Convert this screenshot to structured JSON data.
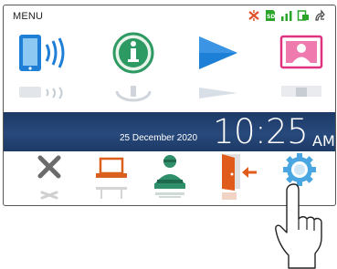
{
  "header": {
    "title": "MENU",
    "status_icons": [
      "mute-icon",
      "sd-card-icon",
      "signal-icon",
      "recording-icon",
      "power-save-icon"
    ]
  },
  "apps": [
    {
      "name": "intercom-icon"
    },
    {
      "name": "information-icon"
    },
    {
      "name": "playback-icon"
    },
    {
      "name": "contacts-icon"
    }
  ],
  "clock": {
    "date": "25 December 2020",
    "time": "10:25",
    "ampm": "AM"
  },
  "tools": [
    {
      "name": "close-icon"
    },
    {
      "name": "monitor-icon"
    },
    {
      "name": "concierge-icon"
    },
    {
      "name": "exit-door-icon"
    },
    {
      "name": "settings-gear-icon"
    }
  ],
  "colors": {
    "clock_bar": "#1e3a66",
    "mute": "#e0502a",
    "signal": "#2aa52a",
    "intercom": "#1f7fd6",
    "information": "#2e9a63",
    "playback": "#1e7fd6",
    "contacts": "#e0327e",
    "exit": "#e05a1a",
    "settings": "#4aa6e0"
  }
}
